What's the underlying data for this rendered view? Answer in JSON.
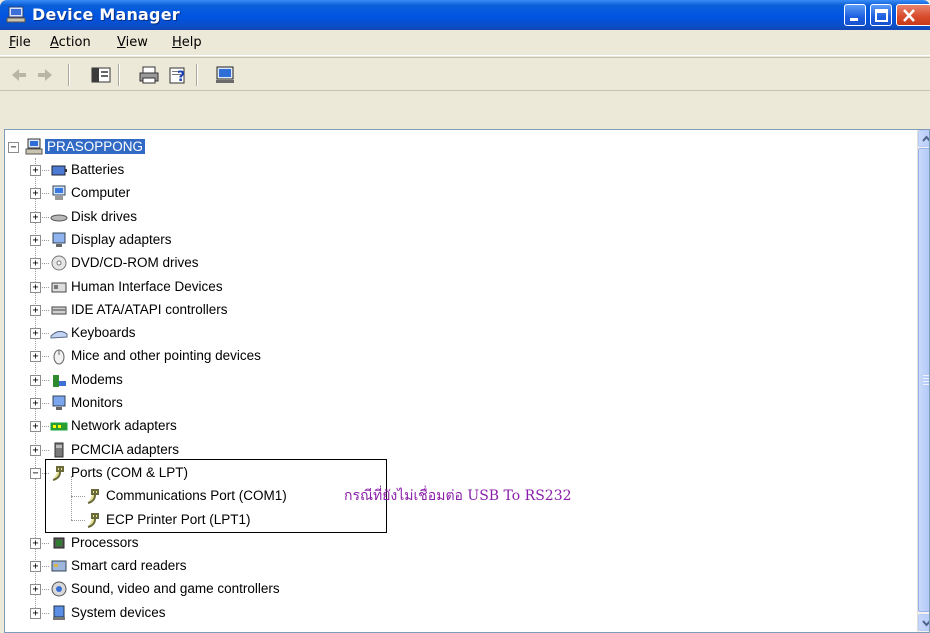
{
  "window": {
    "title": "Device Manager"
  },
  "menu": [
    {
      "label": "File",
      "u": "F",
      "rest": "ile"
    },
    {
      "label": "Action",
      "u": "A",
      "rest": "ction"
    },
    {
      "label": "View",
      "u": "V",
      "rest": "iew"
    },
    {
      "label": "Help",
      "u": "H",
      "rest": "elp"
    }
  ],
  "toolbar": {
    "icons": [
      "back-arrow-icon",
      "forward-arrow-icon",
      "show-hide-console-tree-icon",
      "print-icon",
      "properties-help-icon",
      "scan-hardware-icon"
    ]
  },
  "tree": {
    "root": "PRASOPPONG",
    "categories": [
      {
        "label": "Batteries",
        "icon": "battery-icon"
      },
      {
        "label": "Computer",
        "icon": "computer-icon"
      },
      {
        "label": "Disk drives",
        "icon": "disk-drive-icon"
      },
      {
        "label": "Display adapters",
        "icon": "display-adapter-icon"
      },
      {
        "label": "DVD/CD-ROM drives",
        "icon": "dvd-drive-icon"
      },
      {
        "label": "Human Interface Devices",
        "icon": "hid-icon"
      },
      {
        "label": "IDE ATA/ATAPI controllers",
        "icon": "ide-controller-icon"
      },
      {
        "label": "Keyboards",
        "icon": "keyboard-icon"
      },
      {
        "label": "Mice and other pointing devices",
        "icon": "mouse-icon"
      },
      {
        "label": "Modems",
        "icon": "modem-icon"
      },
      {
        "label": "Monitors",
        "icon": "monitor-icon"
      },
      {
        "label": "Network adapters",
        "icon": "network-adapter-icon"
      },
      {
        "label": "PCMCIA adapters",
        "icon": "pcmcia-icon"
      },
      {
        "label": "Ports (COM & LPT)",
        "icon": "port-icon",
        "expanded": true
      },
      {
        "label": "Processors",
        "icon": "processor-icon"
      },
      {
        "label": "Smart card readers",
        "icon": "smart-card-icon"
      },
      {
        "label": "Sound, video and game controllers",
        "icon": "sound-icon"
      },
      {
        "label": "System devices",
        "icon": "system-device-icon"
      }
    ],
    "ports_children": [
      "Communications Port (COM1)",
      "ECP Printer Port (LPT1)"
    ]
  },
  "annotation": {
    "text": "กรณีที่ยังไม่เชื่อมต่อ USB To RS232"
  },
  "colors": {
    "titlebar": "#0054e3",
    "selection": "#316ac5",
    "annotation": "#8a1ea8"
  }
}
